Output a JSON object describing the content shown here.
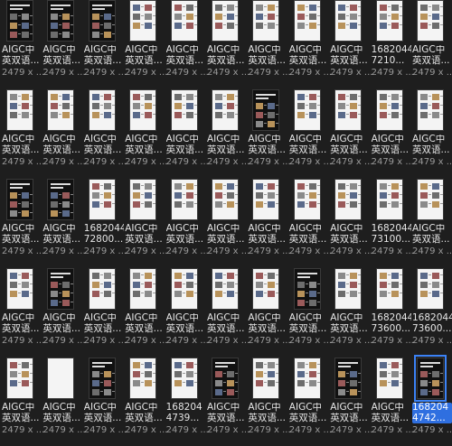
{
  "files": {
    "items": [
      {
        "name": "AIGC中\n英双语...",
        "dims": "2479 x ...",
        "dark": true,
        "cover": true
      },
      {
        "name": "AIGC中\n英双语...",
        "dims": "2479 x ...",
        "dark": true
      },
      {
        "name": "AIGC中\n英双语...",
        "dims": "2479 x ...",
        "dark": true
      },
      {
        "name": "AIGC中\n英双语...",
        "dims": "2479 x ..."
      },
      {
        "name": "AIGC中\n英双语...",
        "dims": "2479 x ..."
      },
      {
        "name": "AIGC中\n英双语...",
        "dims": "2479 x ..."
      },
      {
        "name": "AIGC中\n英双语...",
        "dims": "2479 x ..."
      },
      {
        "name": "AIGC中\n英双语...",
        "dims": "2479 x ..."
      },
      {
        "name": "AIGC中\n英双语...",
        "dims": "2479 x ..."
      },
      {
        "name": "1682044\n7210...",
        "dims": "2479 x ..."
      },
      {
        "name": "AIGC中\n英双语...",
        "dims": "2479 x ..."
      },
      {
        "name": "AIGC中\n英双语...",
        "dims": "2479 x ..."
      },
      {
        "name": "AIGC中\n英双语...",
        "dims": "2479 x ..."
      },
      {
        "name": "AIGC中\n英双语...",
        "dims": "2479 x ..."
      },
      {
        "name": "AIGC中\n英双语...",
        "dims": "2479 x ..."
      },
      {
        "name": "AIGC中\n英双语...",
        "dims": "2479 x ..."
      },
      {
        "name": "AIGC中\n英双语...",
        "dims": "2479 x ..."
      },
      {
        "name": "AIGC中\n英双语...",
        "dims": "2479 x ...",
        "dark": true
      },
      {
        "name": "AIGC中\n英双语...",
        "dims": "2479 x ..."
      },
      {
        "name": "AIGC中\n英双语...",
        "dims": "2479 x ..."
      },
      {
        "name": "AIGC中\n英双语...",
        "dims": "2479 x ..."
      },
      {
        "name": "AIGC中\n英双语...",
        "dims": "2479 x ..."
      },
      {
        "name": "AIGC中\n英双语...",
        "dims": "2479 x ...",
        "dark": true
      },
      {
        "name": "AIGC中\n英双语...",
        "dims": "2479 x ...",
        "dark": true
      },
      {
        "name": "1682044\n72800...",
        "dims": "2479 x ..."
      },
      {
        "name": "AIGC中\n英双语...",
        "dims": "2479 x ..."
      },
      {
        "name": "AIGC中\n英双语...",
        "dims": "2479 x ..."
      },
      {
        "name": "AIGC中\n英双语...",
        "dims": "2479 x ..."
      },
      {
        "name": "AIGC中\n英双语...",
        "dims": "2479 x ..."
      },
      {
        "name": "AIGC中\n英双语...",
        "dims": "2479 x ..."
      },
      {
        "name": "AIGC中\n英双语...",
        "dims": "2479 x ..."
      },
      {
        "name": "1682044\n73100...",
        "dims": "2479 x ..."
      },
      {
        "name": "AIGC中\n英双语...",
        "dims": "2479 x ..."
      },
      {
        "name": "AIGC中\n英双语...",
        "dims": "2479 x ..."
      },
      {
        "name": "AIGC中\n英双语...",
        "dims": "2479 x ...",
        "dark": true
      },
      {
        "name": "AIGC中\n英双语...",
        "dims": "2479 x ..."
      },
      {
        "name": "AIGC中\n英双语...",
        "dims": "2479 x ..."
      },
      {
        "name": "AIGC中\n英双语...",
        "dims": "2479 x ..."
      },
      {
        "name": "AIGC中\n英双语...",
        "dims": "2479 x ..."
      },
      {
        "name": "AIGC中\n英双语...",
        "dims": "2479 x ..."
      },
      {
        "name": "AIGC中\n英双语...",
        "dims": "2479 x ...",
        "dark": true
      },
      {
        "name": "AIGC中\n英双语...",
        "dims": "2479 x ..."
      },
      {
        "name": "1682044\n73600...",
        "dims": "2479 x ..."
      },
      {
        "name": "1682044\n73600...",
        "dims": "2479 x ..."
      },
      {
        "name": "AIGC中\n英双语...",
        "dims": "2479 x ..."
      },
      {
        "name": "AIGC中\n英双语...",
        "dims": "2479 x ...",
        "blank": true
      },
      {
        "name": "AIGC中\n英双语...",
        "dims": "2479 x ...",
        "dark": true
      },
      {
        "name": "AIGC中\n英双语...",
        "dims": "2479 x ..."
      },
      {
        "name": "168204\n4739...",
        "dims": "2479 x ..."
      },
      {
        "name": "AIGC中\n英双语...",
        "dims": "2479 x ...",
        "dark": true
      },
      {
        "name": "AIGC中\n英双语...",
        "dims": "2479 x ..."
      },
      {
        "name": "AIGC中\n英双语...",
        "dims": "2479 x ..."
      },
      {
        "name": "AIGC中\n英双语...",
        "dims": "2479 x ...",
        "dark": true
      },
      {
        "name": "AIGC中\n英双语...",
        "dims": "2479 x ..."
      },
      {
        "name": "168204\n4742...",
        "dims": "2479 x ...",
        "dark": true,
        "selected": true
      }
    ]
  },
  "colors": {
    "background": "#1e1e1e",
    "selection": "#2f6fe0"
  }
}
